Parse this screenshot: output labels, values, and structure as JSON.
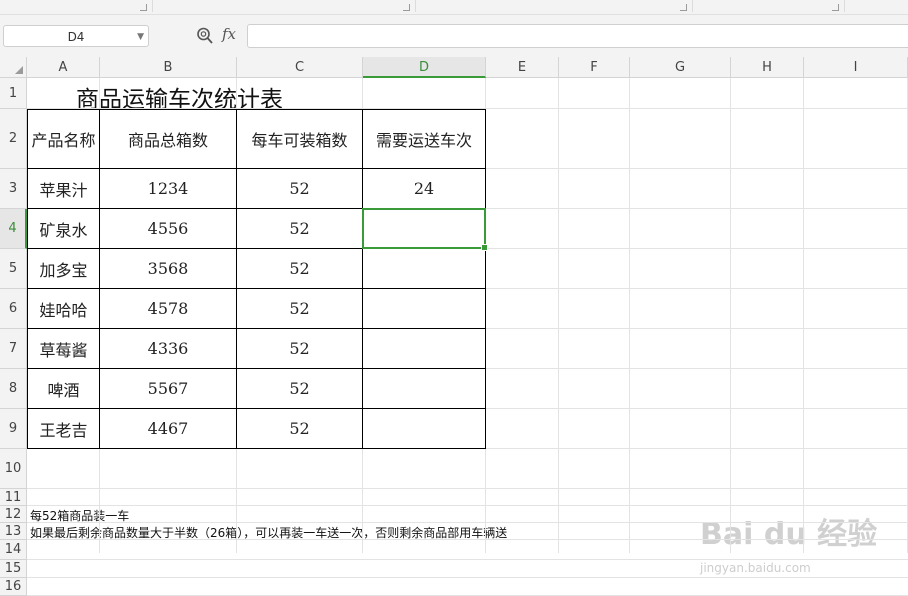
{
  "formula_bar": {
    "cell_ref": "D4",
    "fx_symbol": "fx",
    "formula": ""
  },
  "columns": [
    "A",
    "B",
    "C",
    "D",
    "E",
    "F",
    "G",
    "H",
    "I"
  ],
  "selected_column": "D",
  "rows": [
    "1",
    "2",
    "3",
    "4",
    "5",
    "6",
    "7",
    "8",
    "9",
    "10",
    "11",
    "12",
    "13",
    "14",
    "15",
    "16"
  ],
  "selected_row": "4",
  "sheet": {
    "title": "商品运输车次统计表",
    "headers": [
      "产品名称",
      "商品总箱数",
      "每车可装箱数",
      "需要运送车次"
    ],
    "table_rows": [
      [
        "苹果汁",
        "1234",
        "52",
        "24"
      ],
      [
        "矿泉水",
        "4556",
        "52",
        ""
      ],
      [
        "加多宝",
        "3568",
        "52",
        ""
      ],
      [
        "娃哈哈",
        "4578",
        "52",
        ""
      ],
      [
        "草莓酱",
        "4336",
        "52",
        ""
      ],
      [
        "啤酒",
        "5567",
        "52",
        ""
      ],
      [
        "王老吉",
        "4467",
        "52",
        ""
      ]
    ],
    "notes": [
      "每52箱商品装一车",
      "如果最后剩余商品数量大于半数（26箱），可以再装一车送一次，否则剩余商品部用车辆送"
    ]
  },
  "watermark": {
    "brand": "Bai du 经验",
    "url": "jingyan.baidu.com"
  },
  "colors": {
    "selection": "#3a9a3a",
    "gridline": "#e3e3e3",
    "header_bg": "#f3f3f3"
  }
}
